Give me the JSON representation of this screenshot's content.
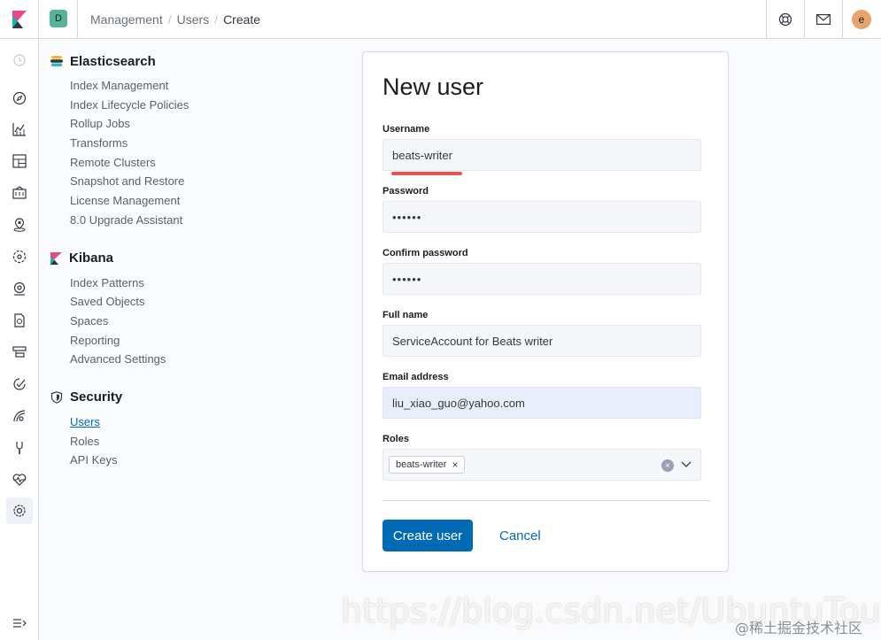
{
  "header": {
    "space_initial": "D",
    "breadcrumbs": [
      "Management",
      "Users",
      "Create"
    ],
    "avatar_initial": "e"
  },
  "sidenav": {
    "sections": [
      {
        "title": "Elasticsearch",
        "items": [
          "Index Management",
          "Index Lifecycle Policies",
          "Rollup Jobs",
          "Transforms",
          "Remote Clusters",
          "Snapshot and Restore",
          "License Management",
          "8.0 Upgrade Assistant"
        ]
      },
      {
        "title": "Kibana",
        "items": [
          "Index Patterns",
          "Saved Objects",
          "Spaces",
          "Reporting",
          "Advanced Settings"
        ]
      },
      {
        "title": "Security",
        "items": [
          "Users",
          "Roles",
          "API Keys"
        ],
        "selected": "Users"
      }
    ]
  },
  "form": {
    "title": "New user",
    "username_label": "Username",
    "username_value": "beats-writer",
    "password_label": "Password",
    "password_value": "••••••",
    "confirm_label": "Confirm password",
    "confirm_value": "••••••",
    "fullname_label": "Full name",
    "fullname_value": "ServiceAccount for Beats writer",
    "email_label": "Email address",
    "email_value": "liu_xiao_guo@yahoo.com",
    "roles_label": "Roles",
    "roles": [
      "beats-writer"
    ],
    "create_label": "Create user",
    "cancel_label": "Cancel"
  },
  "watermark": {
    "url": "https://blog.csdn.net/UbuntuTouch",
    "credit": "@稀土掘金技术社区"
  },
  "colors": {
    "accent": "#006bb4",
    "annotation": "#e0594c"
  }
}
